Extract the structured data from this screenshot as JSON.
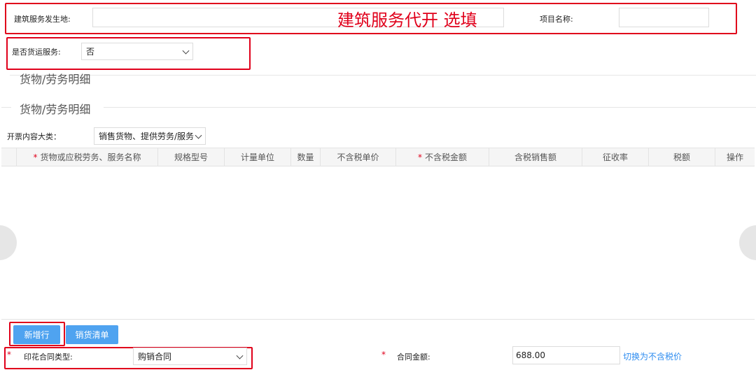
{
  "top_form": {
    "service_location_label": "建筑服务发生地:",
    "annotation": "建筑服务代开 选填",
    "project_name_label": "项目名称:",
    "freight_label": "是否货运服务:",
    "freight_value": "否"
  },
  "sections": {
    "title_1": "货物/劳务明细",
    "title_2": "货物/劳务明细"
  },
  "invoice_category": {
    "label": "开票内容大类：",
    "value": "销售货物、提供劳务/服务"
  },
  "table": {
    "headers": [
      {
        "label": "货物或应税劳务、服务名称",
        "required": true
      },
      {
        "label": "规格型号",
        "required": false
      },
      {
        "label": "计量单位",
        "required": false
      },
      {
        "label": "数量",
        "required": false
      },
      {
        "label": "不含税单价",
        "required": false
      },
      {
        "label": "不含税金额",
        "required": true
      },
      {
        "label": "含税销售额",
        "required": false
      },
      {
        "label": "征收率",
        "required": false
      },
      {
        "label": "税额",
        "required": false
      },
      {
        "label": "操作",
        "required": false
      }
    ],
    "rows": []
  },
  "buttons": {
    "add_row": "新增行",
    "sales_list": "销货清单"
  },
  "bottom_form": {
    "stamp_contract_label": "印花合同类型:",
    "stamp_contract_value": "购销合同",
    "contract_amount_label": "合同金额:",
    "contract_amount_value": "688.00",
    "switch_link": "切换为不含税价"
  },
  "colors": {
    "accent_red": "#e0001b",
    "button_blue": "#4fa3f0",
    "link_blue": "#2d8cf0"
  }
}
